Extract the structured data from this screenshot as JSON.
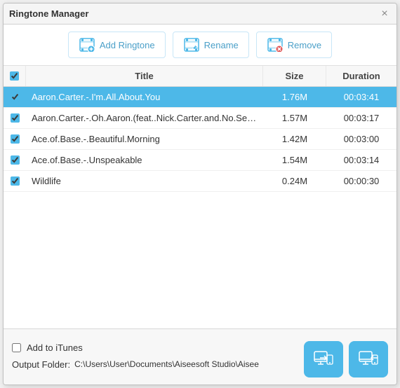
{
  "window": {
    "title": "Ringtone Manager",
    "close_label": "×"
  },
  "toolbar": {
    "add_label": "Add Ringtone",
    "rename_label": "Rename",
    "remove_label": "Remove"
  },
  "table": {
    "columns": [
      "",
      "Title",
      "Size",
      "Duration"
    ],
    "rows": [
      {
        "checked": true,
        "title": "Aaron.Carter.-.I'm.All.About.You",
        "size": "1.76M",
        "duration": "00:03:41",
        "selected": true
      },
      {
        "checked": true,
        "title": "Aaron.Carter.-.Oh.Aaron.(feat..Nick.Carter.and.No.Sec...",
        "size": "1.57M",
        "duration": "00:03:17",
        "selected": false
      },
      {
        "checked": true,
        "title": "Ace.of.Base.-.Beautiful.Morning",
        "size": "1.42M",
        "duration": "00:03:00",
        "selected": false
      },
      {
        "checked": true,
        "title": "Ace.of.Base.-.Unspeakable",
        "size": "1.54M",
        "duration": "00:03:14",
        "selected": false
      },
      {
        "checked": true,
        "title": "Wildlife",
        "size": "0.24M",
        "duration": "00:00:30",
        "selected": false
      }
    ]
  },
  "footer": {
    "add_itunes_label": "Add to iTunes",
    "output_folder_label": "Output Folder:",
    "output_path": "C:\\Users\\User\\Documents\\Aiseesoft Studio\\Aisee",
    "dots_label": "•••"
  },
  "colors": {
    "accent": "#4db8e8",
    "selected_row_bg": "#4db8e8"
  }
}
